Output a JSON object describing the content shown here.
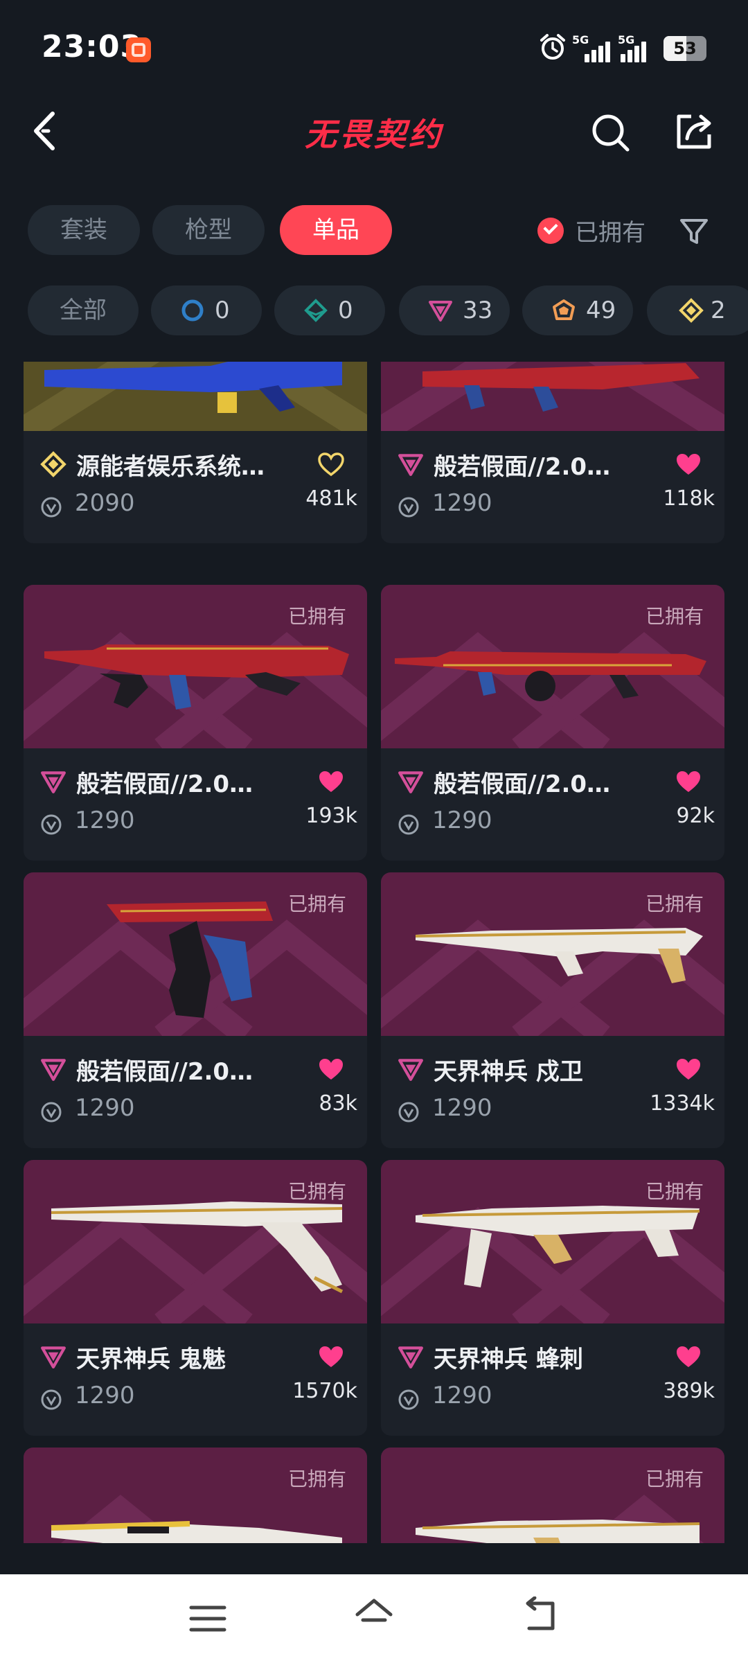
{
  "status_bar": {
    "time": "23:03",
    "network_1": "5G",
    "network_2": "5G",
    "battery_percent": 53
  },
  "header": {
    "title": "无畏契约"
  },
  "tabs": [
    {
      "label": "套装",
      "active": false
    },
    {
      "label": "枪型",
      "active": false
    },
    {
      "label": "单品",
      "active": true
    }
  ],
  "owned_filter": {
    "label": "已拥有",
    "checked": true
  },
  "chips": {
    "all_label": "全部",
    "items": [
      {
        "icon": "select-tier-icon",
        "count": "0",
        "color": "#2f7fc8"
      },
      {
        "icon": "deluxe-tier-icon",
        "count": "0",
        "color": "#1f9c8e"
      },
      {
        "icon": "premium-tier-icon",
        "count": "33",
        "color": "#d44f9a"
      },
      {
        "icon": "exclusive-tier-icon",
        "count": "49",
        "color": "#f29d55"
      },
      {
        "icon": "ultra-tier-icon",
        "count": "2",
        "color": "#f2d56b"
      }
    ]
  },
  "cards": [
    {
      "name": "源能者娱乐系统…",
      "tier": "ultra",
      "price": "2090",
      "likes": "481k",
      "liked": false,
      "owned": false,
      "owned_label": ""
    },
    {
      "name": "般若假面//2.0…",
      "tier": "premium",
      "price": "1290",
      "likes": "118k",
      "liked": true,
      "owned": false,
      "owned_label": ""
    },
    {
      "name": "般若假面//2.0…",
      "tier": "premium",
      "price": "1290",
      "likes": "193k",
      "liked": true,
      "owned": true,
      "owned_label": "已拥有"
    },
    {
      "name": "般若假面//2.0…",
      "tier": "premium",
      "price": "1290",
      "likes": "92k",
      "liked": true,
      "owned": true,
      "owned_label": "已拥有"
    },
    {
      "name": "般若假面//2.0…",
      "tier": "premium",
      "price": "1290",
      "likes": "83k",
      "liked": true,
      "owned": true,
      "owned_label": "已拥有"
    },
    {
      "name": "天界神兵 戍卫",
      "tier": "premium",
      "price": "1290",
      "likes": "1334k",
      "liked": true,
      "owned": true,
      "owned_label": "已拥有"
    },
    {
      "name": "天界神兵 鬼魅",
      "tier": "premium",
      "price": "1290",
      "likes": "1570k",
      "liked": true,
      "owned": true,
      "owned_label": "已拥有"
    },
    {
      "name": "天界神兵 蜂刺",
      "tier": "premium",
      "price": "1290",
      "likes": "389k",
      "liked": true,
      "owned": true,
      "owned_label": "已拥有"
    },
    {
      "name": "",
      "tier": "premium",
      "price": "",
      "likes": "",
      "liked": true,
      "owned": true,
      "owned_label": "已拥有"
    },
    {
      "name": "",
      "tier": "premium",
      "price": "",
      "likes": "",
      "liked": true,
      "owned": true,
      "owned_label": "已拥有"
    }
  ],
  "colors": {
    "accent": "#ff4655",
    "heart": "#ff3f8e",
    "title": "#ff2d48",
    "background": "#151a21",
    "card": "#1c2129"
  }
}
